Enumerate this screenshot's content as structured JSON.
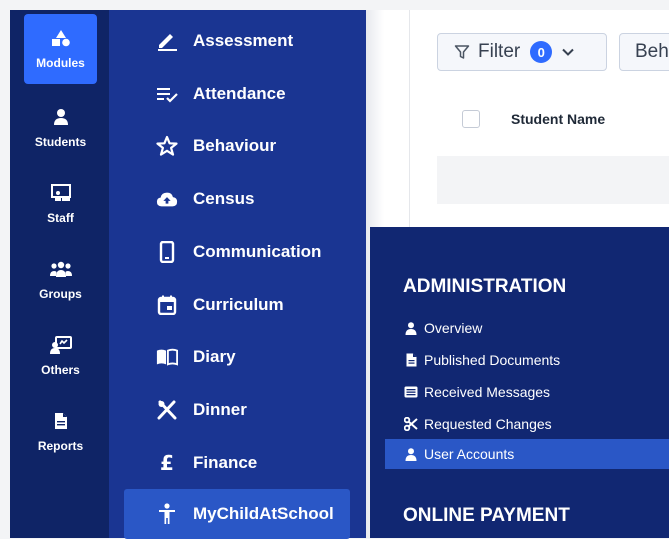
{
  "rail": {
    "items": [
      {
        "label": "Modules",
        "icon": "shapes-icon",
        "active": true
      },
      {
        "label": "Students",
        "icon": "person-icon"
      },
      {
        "label": "Staff",
        "icon": "teacher-board-icon"
      },
      {
        "label": "Groups",
        "icon": "people-group-icon"
      },
      {
        "label": "Others",
        "icon": "chat-person-icon"
      },
      {
        "label": "Reports",
        "icon": "document-icon"
      }
    ]
  },
  "modules": {
    "items": [
      {
        "label": "Assessment",
        "icon": "pen-icon"
      },
      {
        "label": "Attendance",
        "icon": "list-check-icon"
      },
      {
        "label": "Behaviour",
        "icon": "star-icon"
      },
      {
        "label": "Census",
        "icon": "cloud-upload-icon"
      },
      {
        "label": "Communication",
        "icon": "mobile-icon"
      },
      {
        "label": "Curriculum",
        "icon": "calendar-icon"
      },
      {
        "label": "Diary",
        "icon": "book-open-icon"
      },
      {
        "label": "Dinner",
        "icon": "utensils-icon"
      },
      {
        "label": "Finance",
        "icon": "pound-icon"
      },
      {
        "label": "MyChildAtSchool",
        "icon": "child-icon",
        "active": true
      }
    ]
  },
  "toolbar": {
    "filter_label": "Filter",
    "filter_count": "0",
    "behaviour_label": "Beh"
  },
  "table": {
    "header_student_name": "Student Name"
  },
  "admin": {
    "heading": "ADMINISTRATION",
    "items": [
      {
        "label": "Overview",
        "icon": "user-icon"
      },
      {
        "label": "Published Documents",
        "icon": "file-icon"
      },
      {
        "label": "Received Messages",
        "icon": "messages-icon"
      },
      {
        "label": "Requested Changes",
        "icon": "scissors-icon"
      },
      {
        "label": "User Accounts",
        "icon": "user-icon",
        "active": true
      }
    ],
    "heading2": "ONLINE PAYMENT"
  },
  "colors": {
    "rail_bg": "#0f2466",
    "modules_bg": "#1a3592",
    "active_blue": "#2f6bff",
    "active_item": "#2a57c6",
    "admin_bg": "#112772"
  }
}
